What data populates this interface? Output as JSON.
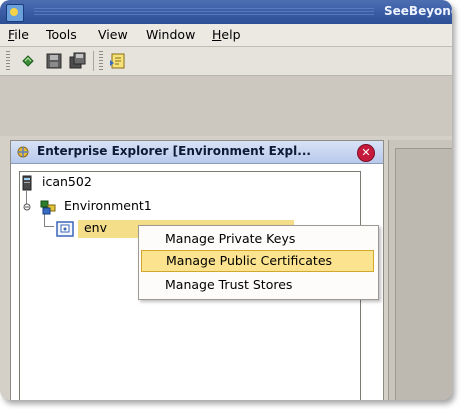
{
  "window": {
    "title": "SeeBeyond"
  },
  "menubar": {
    "items": [
      {
        "label": "File",
        "mnemonic": "F",
        "rest": "ile"
      },
      {
        "label": "Tools"
      },
      {
        "label": "View"
      },
      {
        "label": "Window"
      },
      {
        "label": "Help",
        "mnemonic": "H",
        "rest": "elp"
      }
    ]
  },
  "toolbar": {
    "icons": [
      "refresh-icon",
      "save-icon",
      "save-all-icon",
      "import-icon"
    ]
  },
  "explorer": {
    "title": "Enterprise Explorer [Environment Expl...",
    "close_symbol": "✕",
    "tree": {
      "root": "ican502",
      "environment": "Environment1",
      "child": "env"
    }
  },
  "context_menu": {
    "items": [
      {
        "label": "Manage Private Keys",
        "highlighted": false
      },
      {
        "label": "Manage Public Certificates",
        "highlighted": true
      },
      {
        "label": "Manage Trust Stores",
        "highlighted": false
      }
    ]
  },
  "colors": {
    "highlight": "#fbe38f",
    "selection": "#f4de8a",
    "title_bar": "#3a5da6",
    "close_button": "#c61a3c"
  }
}
